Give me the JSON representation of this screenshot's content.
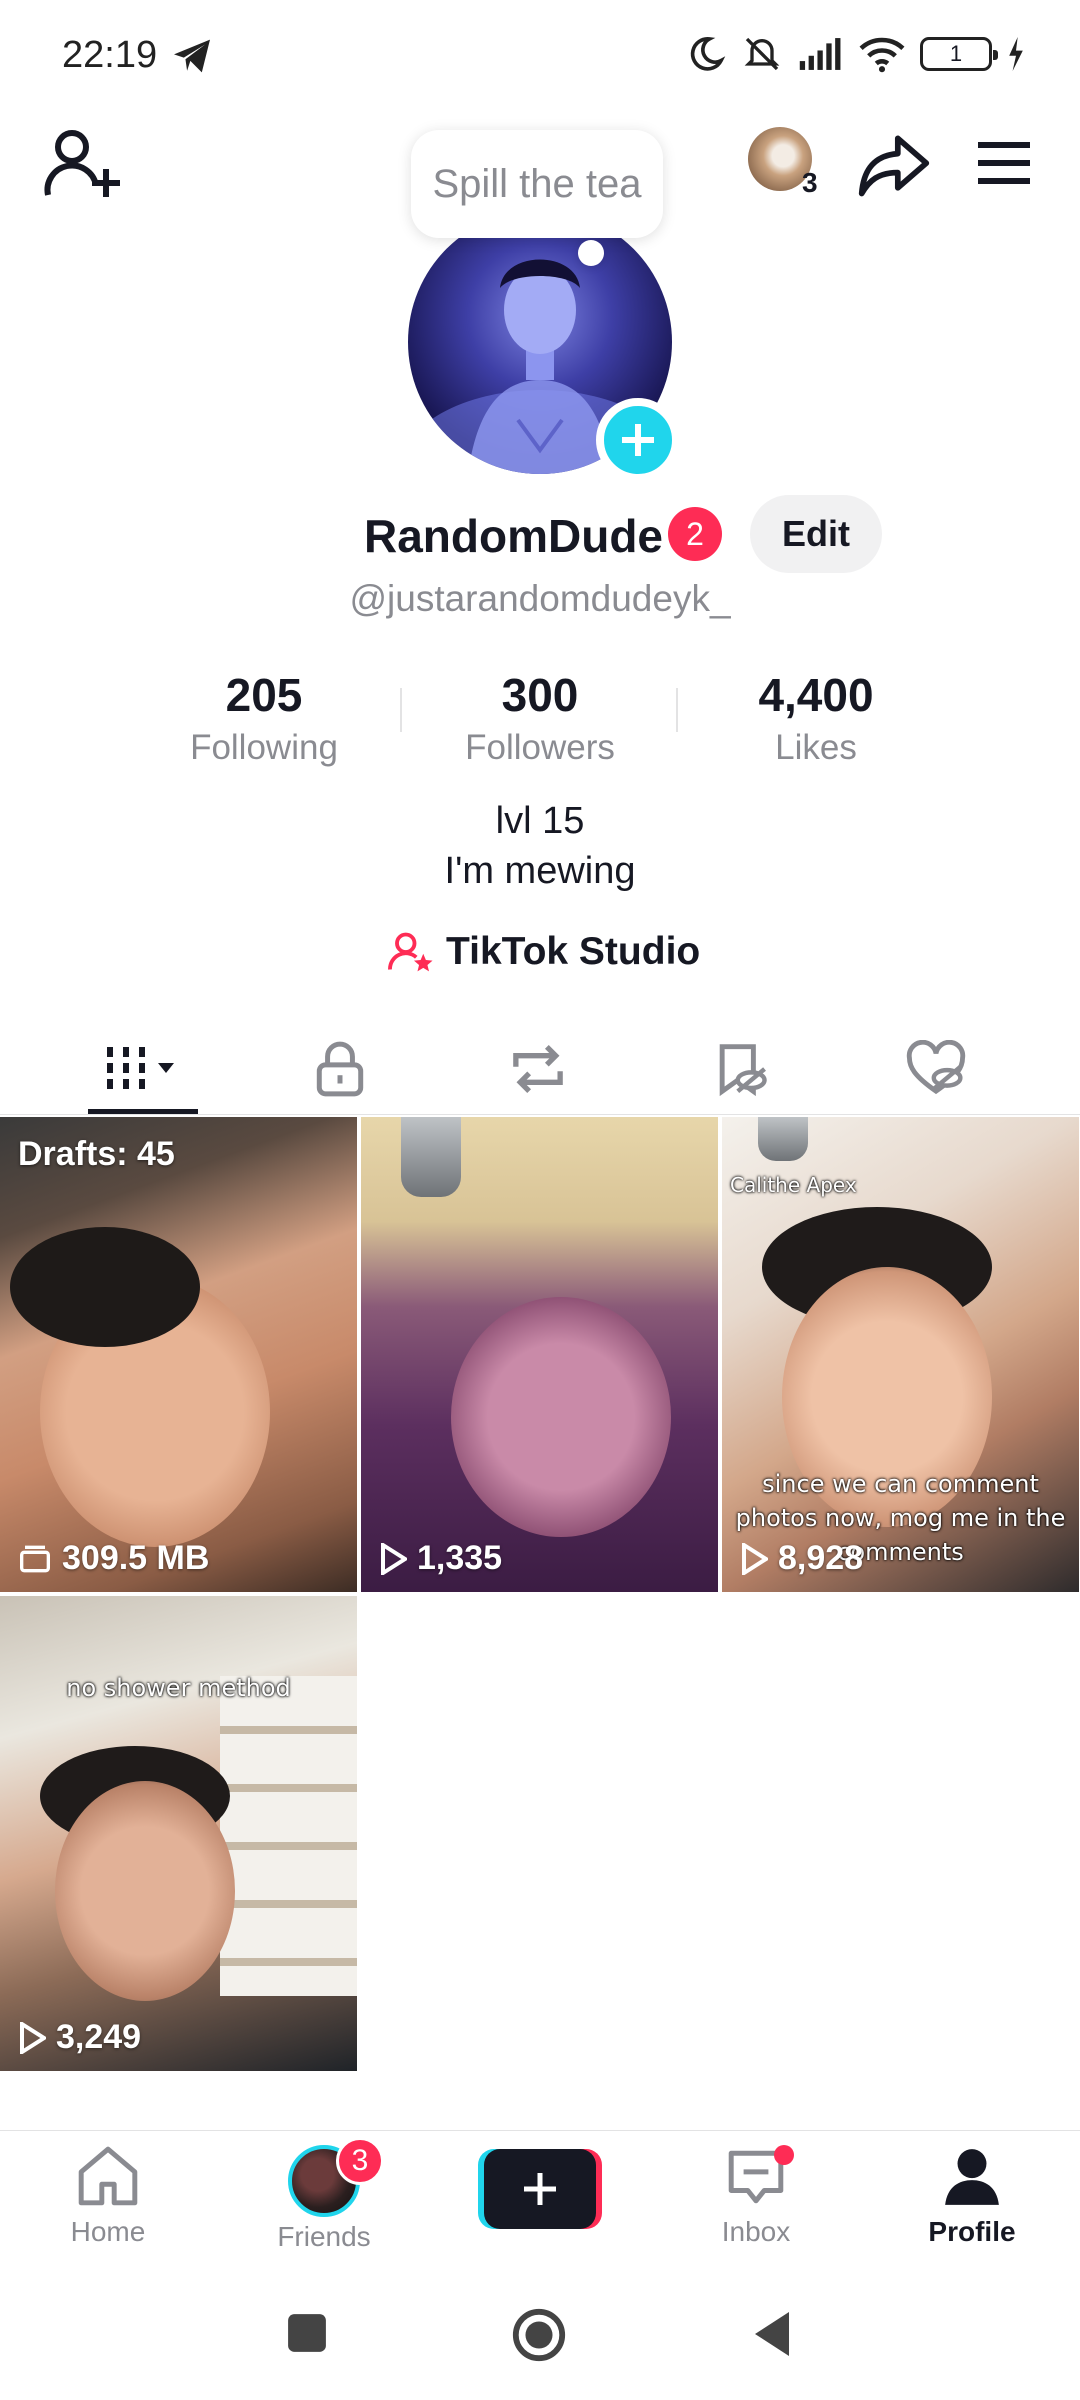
{
  "status_bar": {
    "time": "22:19",
    "battery_level": "1",
    "icons": [
      "telegram-icon",
      "moon-icon",
      "silent-icon",
      "signal-icon",
      "wifi-icon",
      "battery-icon",
      "charging-icon"
    ]
  },
  "top_bar": {
    "avatar_count": "3"
  },
  "note": {
    "text": "Spill the tea"
  },
  "profile": {
    "display_name": "RandomDude",
    "name_badge": "2",
    "edit_label": "Edit",
    "handle": "@justarandomdudeyk_"
  },
  "stats": [
    {
      "value": "205",
      "label": "Following"
    },
    {
      "value": "300",
      "label": "Followers"
    },
    {
      "value": "4,400",
      "label": "Likes"
    }
  ],
  "bio": {
    "line1": "lvl 15",
    "line2": "I'm mewing"
  },
  "studio": {
    "label": "TikTok Studio"
  },
  "tabs": [
    "videos-grid-icon",
    "private-lock-icon",
    "repost-icon",
    "favorites-hidden-icon",
    "liked-hidden-icon"
  ],
  "grid": {
    "drafts_label": "Drafts: 45",
    "drafts_size": "309.5 MB",
    "videos": [
      {
        "views": "1,335",
        "caption": ""
      },
      {
        "views": "8,928",
        "watermark": "Calithe Apex",
        "caption": "since we can comment photos now, mog me in the comments"
      },
      {
        "views": "3,249",
        "caption": "no shower method"
      }
    ]
  },
  "bottom_nav": {
    "home": "Home",
    "friends": "Friends",
    "friends_badge": "3",
    "inbox": "Inbox",
    "profile": "Profile"
  },
  "colors": {
    "accent_red": "#fe2c55",
    "accent_cyan": "#20d5ec",
    "text_primary": "#161823",
    "text_secondary": "#8a8b91"
  }
}
